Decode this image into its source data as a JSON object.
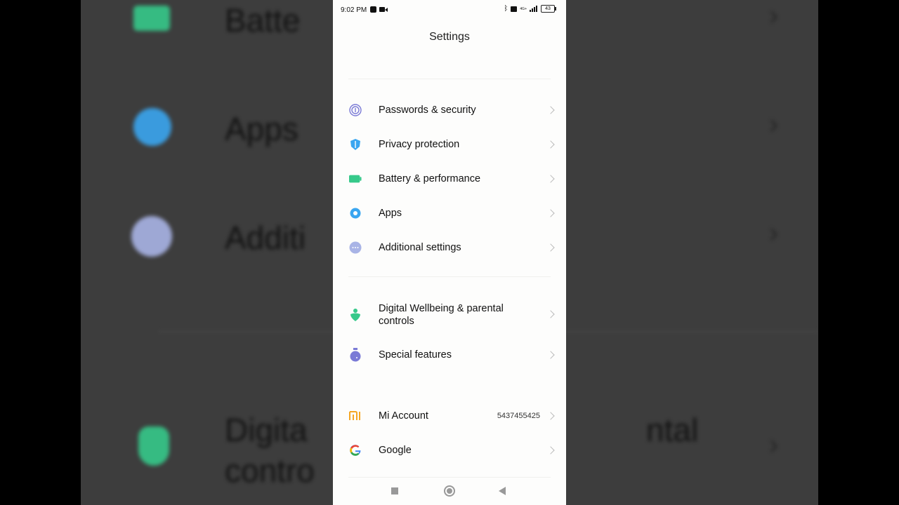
{
  "background": {
    "items": [
      {
        "text": "Batte"
      },
      {
        "text": "Apps"
      },
      {
        "text": "Additi"
      },
      {
        "text_line1": "Digita",
        "text_line2": "contro",
        "right_text": "ntal"
      }
    ]
  },
  "status_bar": {
    "time": "9:02 PM",
    "battery": "43",
    "network": "4G+"
  },
  "header": {
    "title": "Settings"
  },
  "settings_groups": [
    [
      {
        "label": "Passwords & security",
        "icon": "fingerprint-icon",
        "color": "#7a7ad6"
      },
      {
        "label": "Privacy protection",
        "icon": "privacy-shield-icon",
        "color": "#3aa6f0"
      },
      {
        "label": "Battery & performance",
        "icon": "battery-icon",
        "color": "#36c98a"
      },
      {
        "label": "Apps",
        "icon": "gear-icon",
        "color": "#3aa6f0"
      },
      {
        "label": "Additional settings",
        "icon": "more-dots-icon",
        "color": "#a9b4e6"
      }
    ],
    [
      {
        "label_line1": "Digital Wellbeing & parental",
        "label_line2": "controls",
        "icon": "wellbeing-heart-icon",
        "color": "#36c98a"
      },
      {
        "label": "Special features",
        "icon": "flask-icon",
        "color": "#7a7ad6"
      }
    ],
    [
      {
        "label": "Mi Account",
        "value": "5437455425",
        "icon": "mi-logo-icon",
        "color": "#f5a623"
      },
      {
        "label": "Google",
        "icon": "google-icon",
        "color": "#4285f4"
      }
    ]
  ]
}
